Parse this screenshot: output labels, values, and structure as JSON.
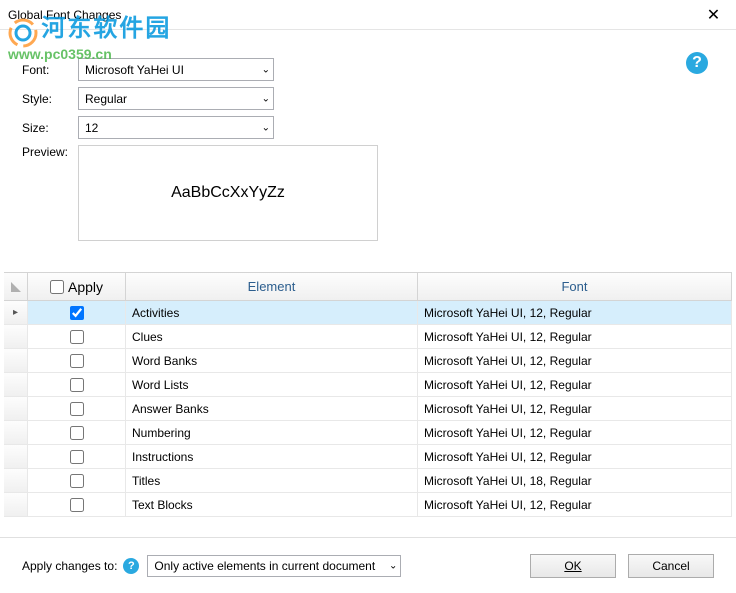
{
  "titlebar": {
    "title": "Global Font Changes"
  },
  "watermark": {
    "big": "河东软件园",
    "small": "www.pc0359.cn"
  },
  "form": {
    "font_label": "Font:",
    "style_label": "Style:",
    "size_label": "Size:",
    "preview_label": "Preview:",
    "font_value": "Microsoft YaHei UI",
    "style_value": "Regular",
    "size_value": "12",
    "preview_text": "AaBbCcXxYyZz"
  },
  "grid": {
    "header_apply": "Apply",
    "header_element": "Element",
    "header_font": "Font",
    "rows": [
      {
        "checked": true,
        "element": "Activities",
        "font": "Microsoft YaHei UI, 12, Regular",
        "selected": true
      },
      {
        "checked": false,
        "element": "Clues",
        "font": "Microsoft YaHei UI, 12, Regular",
        "selected": false
      },
      {
        "checked": false,
        "element": "Word Banks",
        "font": "Microsoft YaHei UI, 12, Regular",
        "selected": false
      },
      {
        "checked": false,
        "element": "Word Lists",
        "font": "Microsoft YaHei UI, 12, Regular",
        "selected": false
      },
      {
        "checked": false,
        "element": "Answer Banks",
        "font": "Microsoft YaHei UI, 12, Regular",
        "selected": false
      },
      {
        "checked": false,
        "element": "Numbering",
        "font": "Microsoft YaHei UI, 12, Regular",
        "selected": false
      },
      {
        "checked": false,
        "element": "Instructions",
        "font": "Microsoft YaHei UI, 12, Regular",
        "selected": false
      },
      {
        "checked": false,
        "element": "Titles",
        "font": "Microsoft YaHei UI, 18, Regular",
        "selected": false
      },
      {
        "checked": false,
        "element": "Text Blocks",
        "font": "Microsoft YaHei UI, 12, Regular",
        "selected": false
      }
    ]
  },
  "footer": {
    "apply_to_label": "Apply changes to:",
    "apply_to_value": "Only active elements in current document",
    "ok_label": "OK",
    "cancel_label": "Cancel"
  }
}
